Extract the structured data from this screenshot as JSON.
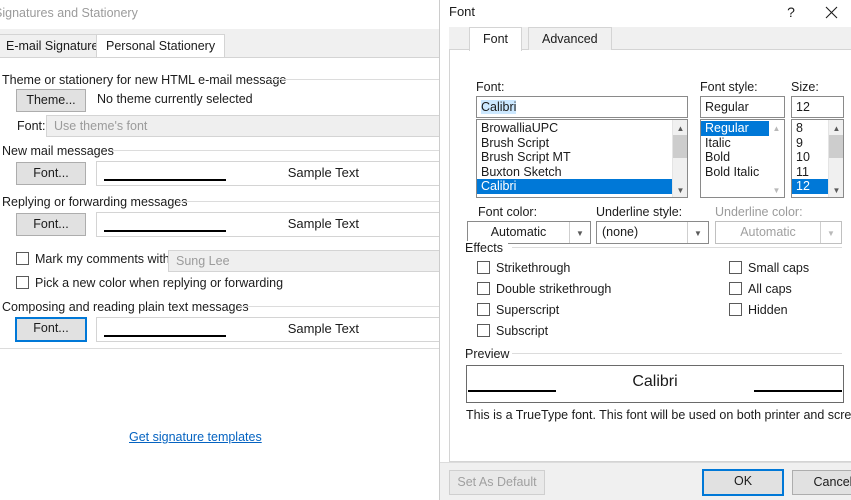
{
  "background_window": {
    "title": "Signatures and Stationery",
    "tabs": [
      {
        "label": "E-mail Signature",
        "active": false
      },
      {
        "label": "Personal Stationery",
        "active": true
      }
    ],
    "groups": {
      "theme": {
        "label": "Theme or stationery for new HTML e-mail message",
        "theme_button": "Theme...",
        "theme_status": "No theme currently selected",
        "font_label": "Font:",
        "font_value": "Use theme's font"
      },
      "new_mail": {
        "label": "New mail messages",
        "font_button": "Font...",
        "sample": "Sample Text"
      },
      "reply": {
        "label": "Replying or forwarding messages",
        "font_button": "Font...",
        "sample": "Sample Text",
        "mark_comments_label": "Mark my comments with:",
        "mark_comments_value": "Sung Lee",
        "pick_color_label": "Pick a new color when replying or forwarding"
      },
      "plain_text": {
        "label": "Composing and reading plain text messages",
        "font_button": "Font...",
        "sample": "Sample Text"
      }
    },
    "signature_templates_link": "Get signature templates"
  },
  "font_dialog": {
    "title": "Font",
    "help_glyph": "?",
    "tabs": [
      {
        "label": "Font",
        "active": true
      },
      {
        "label": "Advanced",
        "active": false
      }
    ],
    "font": {
      "label": "Font:",
      "value": "Calibri",
      "items": [
        {
          "name": "BrowalliaUPC",
          "selected": false
        },
        {
          "name": "Brush Script",
          "selected": false
        },
        {
          "name": "Brush Script MT",
          "selected": false
        },
        {
          "name": "Buxton Sketch",
          "selected": false
        },
        {
          "name": "Calibri",
          "selected": true
        }
      ]
    },
    "font_style": {
      "label": "Font style:",
      "value": "Regular",
      "items": [
        {
          "name": "Regular",
          "selected": true
        },
        {
          "name": "Italic",
          "selected": false
        },
        {
          "name": "Bold",
          "selected": false
        },
        {
          "name": "Bold Italic",
          "selected": false
        }
      ]
    },
    "size": {
      "label": "Size:",
      "value": "12",
      "items": [
        {
          "name": "8",
          "selected": false
        },
        {
          "name": "9",
          "selected": false
        },
        {
          "name": "10",
          "selected": false
        },
        {
          "name": "11",
          "selected": false
        },
        {
          "name": "12",
          "selected": true
        }
      ]
    },
    "font_color": {
      "label": "Font color:",
      "value": "Automatic"
    },
    "underline_style": {
      "label": "Underline style:",
      "value": "(none)"
    },
    "underline_color": {
      "label": "Underline color:",
      "value": "Automatic",
      "disabled": true
    },
    "effects": {
      "label": "Effects",
      "left": [
        {
          "label": "Strikethrough",
          "checked": false
        },
        {
          "label": "Double strikethrough",
          "checked": false
        },
        {
          "label": "Superscript",
          "checked": false
        },
        {
          "label": "Subscript",
          "checked": false
        }
      ],
      "right": [
        {
          "label": "Small caps",
          "checked": false
        },
        {
          "label": "All caps",
          "checked": false
        },
        {
          "label": "Hidden",
          "checked": false
        }
      ]
    },
    "preview": {
      "label": "Preview",
      "sample_name": "Calibri",
      "note": "This is a TrueType font. This font will be used on both printer and screen."
    },
    "buttons": {
      "set_as_default": "Set As Default",
      "ok": "OK",
      "cancel": "Cancel"
    }
  },
  "colors": {
    "accent": "#0078d7",
    "link": "#0563c1",
    "selection_text": "#cce8ff",
    "dialog_bg": "#ffffff",
    "control_face": "#f0f0f0"
  }
}
